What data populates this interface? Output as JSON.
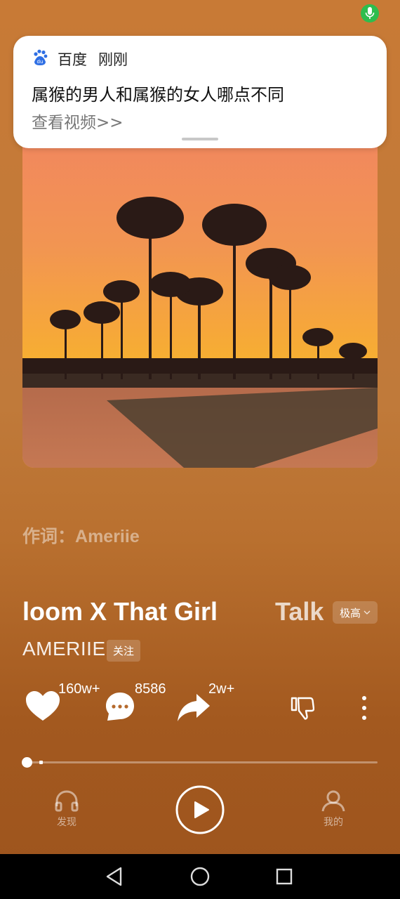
{
  "notification": {
    "app_name": "百度",
    "time": "刚刚",
    "title": "属猴的男人和属猴的女人哪点不同",
    "link": "查看视频>>",
    "brand_color": "#2f6fe4"
  },
  "player": {
    "lyricist_label": "作词：",
    "lyricist_name": "Ameriie",
    "song_title": "loom X That Girl",
    "song_title_next": "Talk",
    "quality": "极高",
    "artist": "AMERIIE",
    "follow_label": "关注",
    "like_count": "160w+",
    "comment_count": "8586",
    "share_count": "2w+",
    "progress": 0.0
  },
  "bottom_nav": {
    "discover_label": "发现",
    "mine_label": "我的"
  },
  "colors": {
    "accent_green": "#2ebd4e",
    "bg_top": "#c87a36",
    "bg_bottom": "#9d541e"
  },
  "icons": [
    "mic-icon",
    "baidu-paw-icon",
    "heart-icon",
    "comment-icon",
    "share-icon",
    "dislike-icon",
    "more-icon",
    "headphones-icon",
    "play-icon",
    "user-icon",
    "back-icon",
    "home-icon",
    "recents-icon"
  ]
}
